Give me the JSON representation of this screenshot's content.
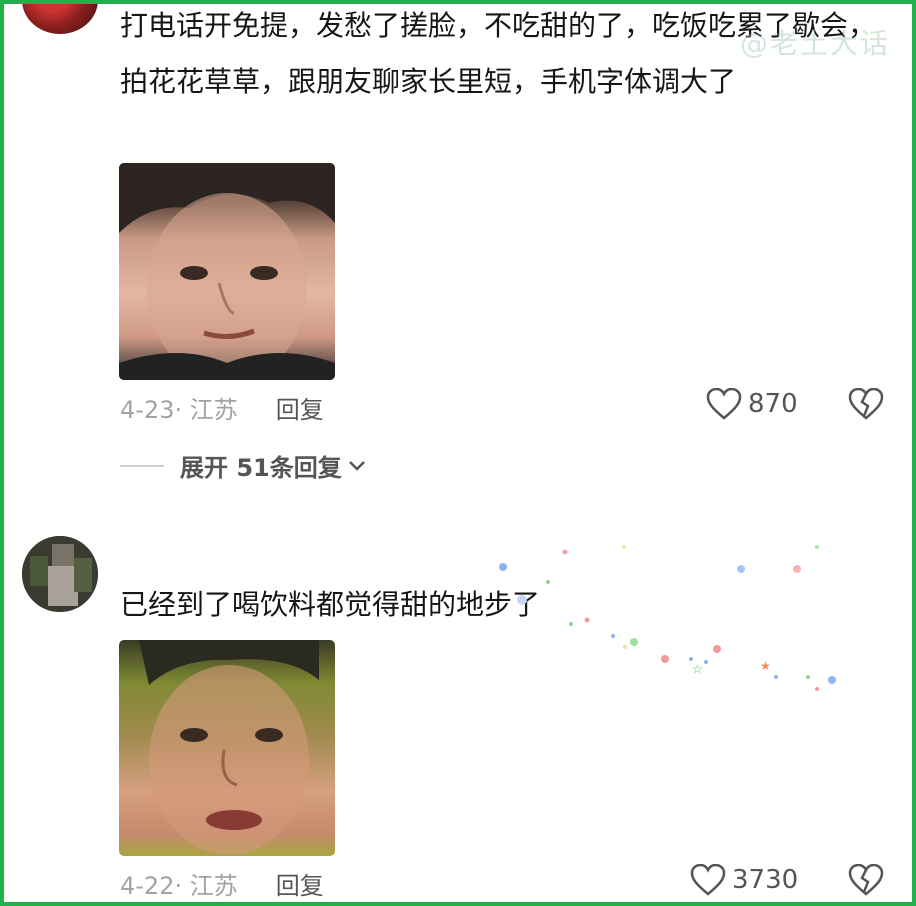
{
  "watermark": "@老土大话",
  "comments": [
    {
      "text": "打电话开免提，发愁了搓脸，不吃甜的了，吃饭吃累了歇会，拍花花草草，跟朋友聊家长里短，手机字体调大了",
      "date_location": "4-23· 江苏",
      "reply_label": "回复",
      "likes": "870",
      "expand_label": "展开 51条回复"
    },
    {
      "text": "已经到了喝饮料都觉得甜的地步了",
      "date_location": "4-22· 江苏",
      "reply_label": "回复",
      "likes": "3730"
    }
  ],
  "colors": {
    "frame": "#1fb24a",
    "meta": "#a3a3a3",
    "action": "#555555"
  },
  "icons": {
    "like": "heart-outline-icon",
    "dislike": "broken-heart-icon",
    "expand": "chevron-down-icon"
  }
}
